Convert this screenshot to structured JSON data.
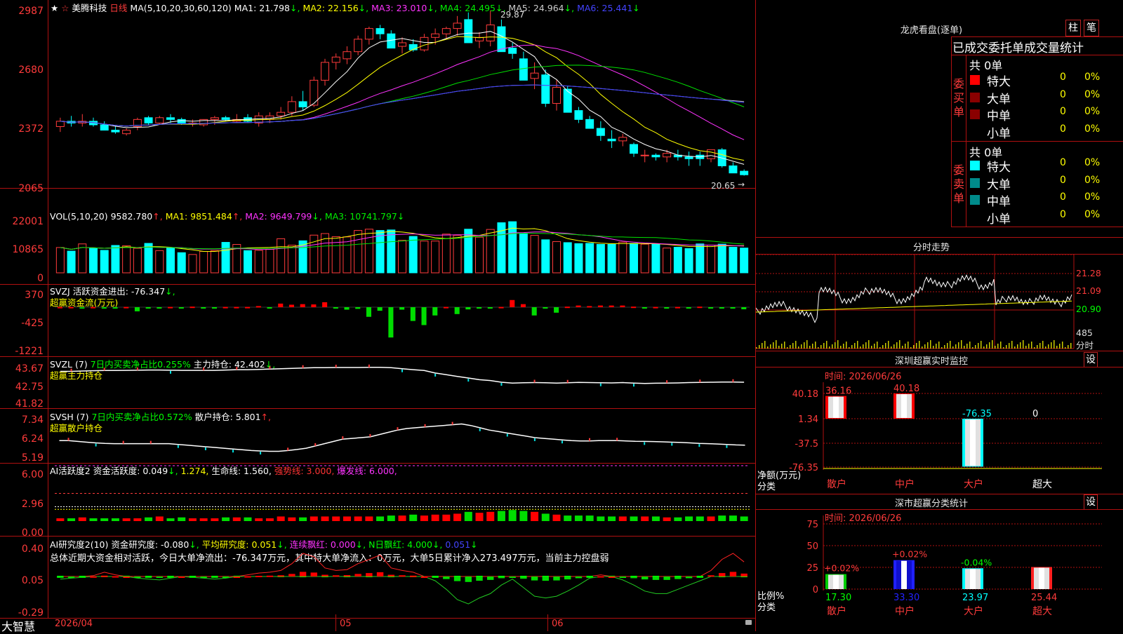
{
  "colors": {
    "up": "#ff3b3b",
    "down": "#00ffff",
    "frame": "#b01010",
    "ma1": "#ffffff",
    "ma2": "#ffff00",
    "ma3": "#ff33ff",
    "ma4": "#00e000",
    "ma5": "#c0c0c0",
    "ma6": "#3b3bff"
  },
  "window": {
    "star": "★",
    "pin": "☆",
    "stock_name": "美腾科技",
    "period": "日线",
    "app_name": "大智慧",
    "bottom_dates": [
      "2026/04",
      "05",
      "06"
    ],
    "lock_icon": "lock-icon"
  },
  "kline": {
    "ticks": [
      "2987",
      "2680",
      "2372",
      "2065"
    ],
    "label_ma": "MA(5,10,20,30,60,120)",
    "ma1": "MA1: 21.798",
    "ma2": "MA2: 22.156",
    "ma3": "MA3: 23.010",
    "ma4": "MA4: 24.495",
    "ma5": "MA5: 24.964",
    "ma6": "MA6: 25.441",
    "high_label": "29.87",
    "low_label": "20.65",
    "chart_data": {
      "type": "candlestick",
      "title": "美腾科技 日线",
      "ohlc": [
        [
          23.4,
          23.9,
          23.1,
          23.7
        ],
        [
          23.7,
          24.0,
          23.4,
          23.6
        ],
        [
          23.6,
          24.1,
          23.4,
          23.7
        ],
        [
          23.7,
          23.9,
          23.4,
          23.5
        ],
        [
          23.5,
          23.7,
          23.2,
          23.2
        ],
        [
          23.2,
          23.4,
          23.0,
          23.1
        ],
        [
          23.0,
          23.3,
          22.9,
          23.2
        ],
        [
          23.4,
          23.9,
          23.2,
          23.8
        ],
        [
          23.9,
          24.0,
          23.5,
          23.6
        ],
        [
          23.6,
          24.0,
          23.5,
          23.9
        ],
        [
          23.9,
          24.1,
          23.6,
          23.8
        ],
        [
          23.8,
          23.9,
          23.5,
          23.6
        ],
        [
          23.6,
          23.8,
          23.4,
          23.6
        ],
        [
          23.5,
          23.8,
          23.4,
          23.8
        ],
        [
          23.8,
          24.0,
          23.5,
          23.9
        ],
        [
          23.9,
          24.0,
          23.7,
          23.8
        ],
        [
          23.7,
          24.1,
          23.6,
          23.8
        ],
        [
          23.9,
          24.1,
          23.6,
          23.7
        ],
        [
          23.6,
          24.2,
          23.4,
          24.0
        ],
        [
          23.8,
          24.2,
          23.6,
          24.0
        ],
        [
          24.0,
          24.5,
          23.8,
          24.2
        ],
        [
          24.2,
          25.1,
          24.0,
          24.8
        ],
        [
          24.8,
          25.4,
          24.3,
          24.5
        ],
        [
          24.6,
          26.2,
          24.5,
          26.0
        ],
        [
          26.0,
          27.2,
          25.7,
          27.0
        ],
        [
          27.0,
          27.5,
          26.6,
          27.3
        ],
        [
          27.2,
          27.9,
          26.9,
          27.6
        ],
        [
          27.6,
          28.5,
          27.4,
          28.3
        ],
        [
          28.3,
          29.0,
          28.0,
          28.9
        ],
        [
          28.9,
          29.1,
          28.3,
          28.6
        ],
        [
          28.6,
          28.8,
          27.8,
          27.8
        ],
        [
          27.9,
          28.4,
          27.5,
          28.1
        ],
        [
          28.0,
          28.3,
          27.6,
          27.7
        ],
        [
          27.7,
          28.6,
          27.6,
          28.4
        ],
        [
          28.4,
          28.9,
          28.0,
          28.6
        ],
        [
          28.6,
          29.0,
          28.3,
          28.9
        ],
        [
          28.9,
          29.6,
          28.5,
          29.2
        ],
        [
          29.4,
          29.8,
          28.1,
          28.1
        ],
        [
          28.2,
          28.7,
          27.8,
          28.4
        ],
        [
          28.2,
          29.9,
          27.9,
          29.1
        ],
        [
          29.0,
          29.4,
          27.6,
          27.6
        ],
        [
          27.8,
          28.1,
          27.2,
          27.5
        ],
        [
          27.2,
          27.6,
          26.0,
          26.0
        ],
        [
          26.1,
          27.0,
          25.5,
          26.4
        ],
        [
          26.3,
          26.6,
          24.5,
          24.7
        ],
        [
          24.7,
          26.0,
          24.3,
          25.6
        ],
        [
          25.5,
          25.7,
          24.2,
          24.2
        ],
        [
          24.3,
          24.5,
          23.6,
          23.8
        ],
        [
          23.8,
          24.0,
          23.3,
          23.3
        ],
        [
          23.3,
          23.7,
          22.6,
          22.9
        ],
        [
          22.7,
          23.2,
          22.2,
          22.6
        ],
        [
          22.6,
          23.0,
          22.3,
          22.8
        ],
        [
          22.4,
          22.5,
          21.7,
          21.9
        ],
        [
          21.8,
          22.1,
          21.4,
          21.8
        ],
        [
          21.8,
          21.9,
          21.5,
          21.7
        ],
        [
          21.7,
          22.1,
          21.4,
          21.9
        ],
        [
          21.8,
          22.1,
          21.5,
          21.7
        ],
        [
          21.7,
          22.0,
          21.2,
          21.6
        ],
        [
          21.8,
          22.0,
          21.2,
          21.6
        ],
        [
          21.6,
          22.1,
          21.4,
          22.1
        ],
        [
          22.1,
          22.2,
          21.1,
          21.2
        ],
        [
          21.2,
          21.4,
          20.8,
          20.8
        ],
        [
          20.9,
          21.0,
          20.65,
          20.7
        ]
      ]
    }
  },
  "vol": {
    "ticks": [
      "22001",
      "10865",
      "0"
    ],
    "label": "VOL(5,10,20)",
    "value": "9582.780",
    "ma1": "MA1: 9851.484",
    "ma2": "MA2: 9649.799",
    "ma3": "MA3: 10741.797",
    "chart_data": {
      "type": "bar",
      "values": [
        9800,
        8400,
        11200,
        9500,
        8700,
        10600,
        10500,
        9500,
        11400,
        8600,
        9600,
        7800,
        7100,
        8300,
        8600,
        11800,
        11000,
        8600,
        8700,
        9100,
        13200,
        10700,
        12400,
        14600,
        15200,
        14000,
        13900,
        16400,
        16900,
        16400,
        16600,
        12600,
        14100,
        12300,
        12300,
        15000,
        14500,
        16900,
        13800,
        16800,
        19400,
        19800,
        15100,
        14500,
        12800,
        12100,
        11700,
        11300,
        11400,
        11000,
        11000,
        11900,
        11400,
        11100,
        11000,
        9600,
        9900,
        9400,
        11200,
        10700,
        11100,
        9900,
        9600
      ]
    }
  },
  "svzj": {
    "ticks": [
      "370",
      "-425",
      "-1221"
    ],
    "label": "SVZJ",
    "active_label": "活跃资金进出: -76.347",
    "sub": "超赢资金流(万元)",
    "chart_data": {
      "type": "bar",
      "values": [
        10,
        10,
        -40,
        10,
        -30,
        -40,
        10,
        -150,
        -40,
        -40,
        10,
        -10,
        20,
        -30,
        -30,
        10,
        10,
        10,
        40,
        -10,
        130,
        90,
        110,
        100,
        180,
        -10,
        -90,
        -60,
        -350,
        -130,
        -1100,
        -90,
        -500,
        -650,
        -300,
        10,
        -250,
        -80,
        -20,
        -10,
        10,
        260,
        110,
        -300,
        -30,
        -200,
        20,
        60,
        40,
        60,
        60,
        60,
        20,
        -20,
        10,
        -30,
        10,
        -20,
        20,
        -40,
        -10,
        -30,
        -76
      ]
    }
  },
  "svzl": {
    "ticks": [
      "43.67",
      "42.75",
      "41.82"
    ],
    "label": "SVZL (7)",
    "ratio": "7日内买卖净占比0.255%",
    "hold": "主力持仓: 42.402",
    "sub": "超赢主力持仓",
    "chart_data": {
      "type": "line",
      "values": [
        43.5,
        43.5,
        43.52,
        43.54,
        43.55,
        43.55,
        43.56,
        43.57,
        43.58,
        43.58,
        43.57,
        43.56,
        43.56,
        43.56,
        43.56,
        43.58,
        43.6,
        43.6,
        43.62,
        43.64,
        43.66,
        43.68,
        43.7,
        43.72,
        43.72,
        43.73,
        43.73,
        43.73,
        43.74,
        43.74,
        43.72,
        43.66,
        43.6,
        43.55,
        43.4,
        43.3,
        43.2,
        43.1,
        43.0,
        42.95,
        42.85,
        42.8,
        42.82,
        42.83,
        42.82,
        42.8,
        42.82,
        42.84,
        42.83,
        42.82,
        42.81,
        42.83,
        42.8,
        42.78,
        42.79,
        42.8,
        42.81,
        42.83,
        42.84,
        42.85,
        42.86,
        42.86,
        42.85
      ]
    }
  },
  "svsh": {
    "ticks": [
      "7.34",
      "6.24",
      "5.19"
    ],
    "label": "SVSH (7)",
    "ratio": "7日内买卖净占比0.572%",
    "hold": "散户持仓: 5.801",
    "sub": "超赢散户持仓",
    "chart_data": {
      "type": "line",
      "values": [
        6.1,
        6.1,
        6.05,
        6.0,
        5.95,
        5.92,
        5.9,
        5.9,
        5.9,
        5.9,
        5.9,
        5.9,
        5.9,
        5.85,
        5.8,
        5.75,
        5.7,
        5.65,
        5.6,
        5.55,
        5.5,
        5.45,
        5.42,
        5.4,
        5.4,
        5.45,
        5.52,
        5.6,
        5.75,
        5.9,
        6.05,
        6.2,
        6.25,
        6.3,
        6.35,
        6.5,
        6.65,
        6.8,
        6.9,
        6.95,
        7.0,
        7.05,
        7.1,
        7.15,
        7.2,
        7.1,
        6.95,
        6.8,
        6.7,
        6.6,
        6.5,
        6.4,
        6.3,
        6.25,
        6.2,
        6.15,
        6.1,
        6.08,
        6.08,
        6.1,
        6.1,
        6.1,
        6.08,
        6.06,
        6.05,
        6.04,
        6.02,
        6.0,
        5.98,
        5.95,
        5.92,
        5.9,
        5.88,
        5.85,
        5.82,
        5.8
      ]
    }
  },
  "ai1": {
    "ticks": [
      "6.00",
      "2.96",
      "0.00"
    ],
    "label": "AI活跃度2",
    "degree": "资金活跃度: 0.049",
    "v2": "1.274",
    "life": "生命线: 1.560",
    "strong": "强势线: 3.000",
    "burst": "爆发线: 6.000",
    "chart_data": {
      "type": "bar",
      "values": [
        0.3,
        0.3,
        0.4,
        0.3,
        0.3,
        0.3,
        0.3,
        0.3,
        0.4,
        0.5,
        0.3,
        0.4,
        0.3,
        0.3,
        0.3,
        0.4,
        0.4,
        0.4,
        0.3,
        0.3,
        0.5,
        0.4,
        0.4,
        0.5,
        0.5,
        0.5,
        0.5,
        0.5,
        0.5,
        0.5,
        0.6,
        0.6,
        0.7,
        0.6,
        0.7,
        0.7,
        0.8,
        1.0,
        0.9,
        1.0,
        1.1,
        1.2,
        1.1,
        1.0,
        0.8,
        0.7,
        0.6,
        0.6,
        0.6,
        0.5,
        0.5,
        0.5,
        0.5,
        0.5,
        0.5,
        0.4,
        0.4,
        0.5,
        0.5,
        0.5,
        0.6,
        0.6,
        0.5
      ]
    }
  },
  "ai2": {
    "ticks": [
      "0.40",
      "0.05",
      "-0.29"
    ],
    "label": "AI研究度2(10)",
    "research": "资金研究度: -0.080",
    "avg": "平均研究度: 0.051",
    "cont": "连续飘红: 0.000",
    "n": "N日飘红: 4.000",
    "last": "0.051",
    "summary": "总体近期大资金相对活跃，今日大单净流出：-76.347万元，其中特大单净流入：0万元，大单5日累计净入273.497万元，当前主力控盘弱",
    "chart_data": {
      "type": "line",
      "values": [
        0.02,
        0.03,
        0.04,
        0.06,
        0.1,
        0.07,
        0.05,
        0.03,
        0.02,
        0.01,
        0.03,
        0.05,
        0.04,
        0.03,
        0.02,
        0.03,
        0.05,
        0.07,
        0.09,
        0.1,
        0.12,
        0.2,
        0.32,
        0.28,
        0.15,
        0.12,
        0.13,
        0.2,
        0.25,
        0.3,
        0.15,
        0.12,
        0.1,
        0.05,
        0.0,
        -0.1,
        -0.22,
        -0.27,
        -0.2,
        -0.15,
        -0.05,
        0.02,
        -0.08,
        -0.18,
        -0.2,
        -0.18,
        -0.12,
        -0.05,
        0.03,
        0.07,
        0.05,
        0.01,
        -0.05,
        -0.12,
        -0.15,
        -0.15,
        -0.1,
        -0.05,
        0.0,
        0.12,
        0.25,
        0.32,
        0.22
      ]
    }
  },
  "right": {
    "dragon_title": "龙虎看盘(逐单)",
    "btn_zhu": "柱",
    "btn_bi": "笔",
    "stat_title": "已成交委托单成交量统计",
    "buy_label": "委买单",
    "sell_label": "委卖单",
    "buy_total": "共 0单",
    "sell_total": "共 0单",
    "rows": [
      {
        "name": "特大",
        "v": "0",
        "p": "0%"
      },
      {
        "name": "大单",
        "v": "0",
        "p": "0%"
      },
      {
        "name": "中单",
        "v": "0",
        "p": "0%"
      },
      {
        "name": "小单",
        "v": "0",
        "p": "0%"
      }
    ],
    "buy_swatches": [
      "#ff0000",
      "#8a0000",
      "#8a0000",
      ""
    ],
    "sell_swatches": [
      "#00ffff",
      "#008b8b",
      "#008b8b",
      ""
    ],
    "intraday_title": "分时走势",
    "intraday_ticks": [
      "21.28",
      "21.09",
      "20.90"
    ],
    "intraday_vol": "485",
    "intraday_unit": "分时",
    "sz_monitor_title": "深圳超赢实时监控",
    "set_label": "设",
    "time1": "时间: 2026/06/26",
    "mon_ticks": [
      "40.18",
      "1.34",
      "-37.5",
      "-76.35"
    ],
    "net_label": "净额(万元)",
    "cat_label": "分类",
    "mon_values": [
      "36.16",
      "40.18",
      "-76.35",
      "0"
    ],
    "cats": [
      "散户",
      "中户",
      "大户",
      "超大"
    ],
    "sz_stat_title": "深市超赢分类统计",
    "time2": "时间: 2026/06/26",
    "stat_ticks": [
      "75",
      "50",
      "25",
      "0"
    ],
    "ratio_label": "比例%",
    "stat_changes": [
      "+0.02%",
      "+0.02%",
      "-0.04%",
      ""
    ],
    "stat_values": [
      "17.30",
      "33.30",
      "23.97",
      "25.44"
    ]
  }
}
